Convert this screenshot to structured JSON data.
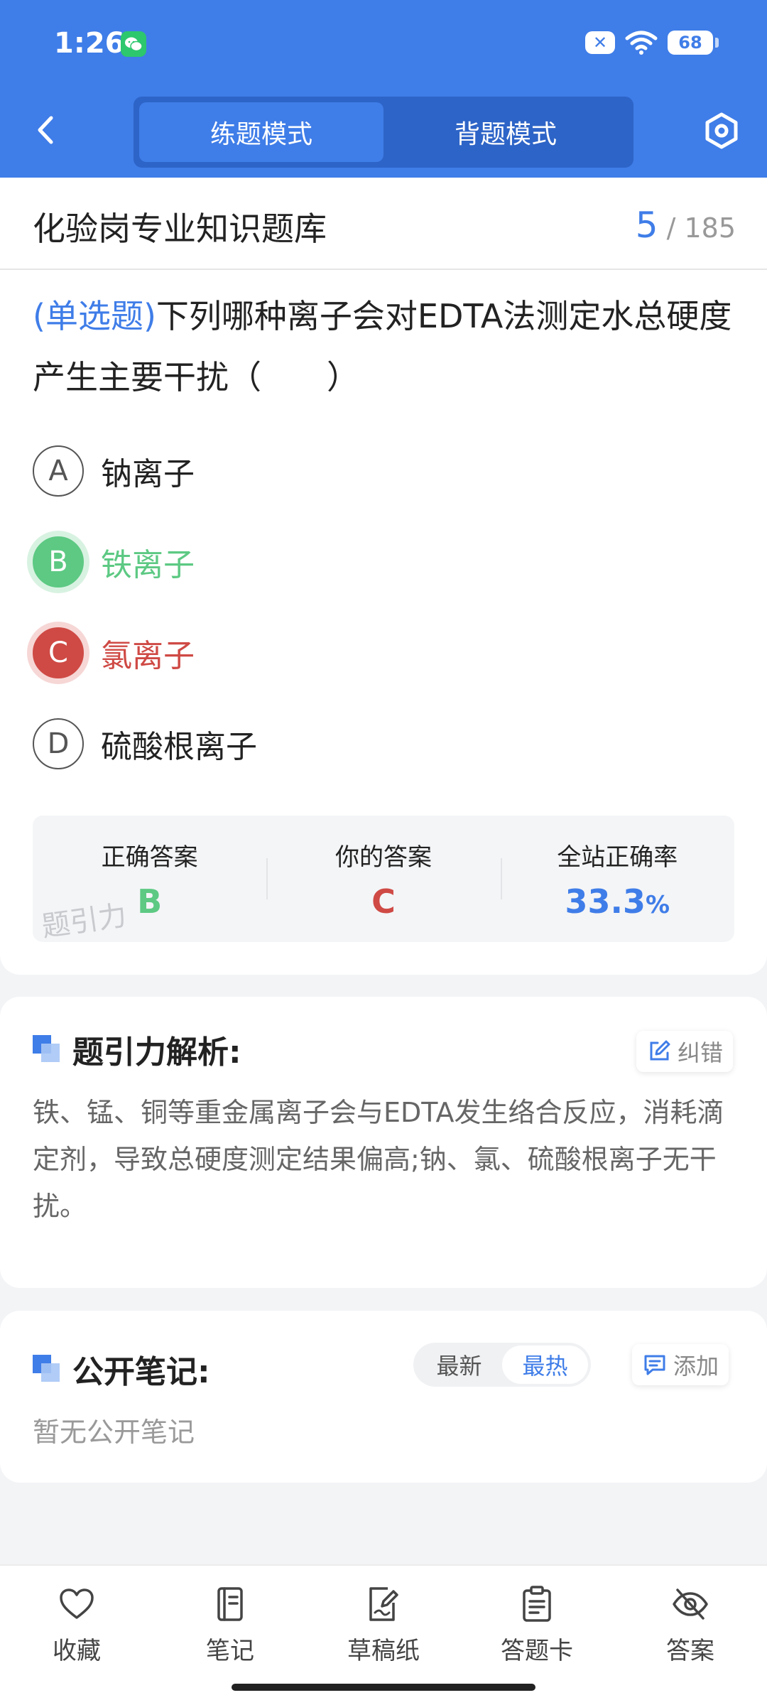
{
  "status_bar": {
    "time": "1:26",
    "battery": "68",
    "muted_badge": "✕"
  },
  "header": {
    "tabs": [
      {
        "label": "练题模式",
        "active": true
      },
      {
        "label": "背题模式",
        "active": false
      }
    ],
    "icons": {
      "back": "chevron-left-icon",
      "settings": "hexagon-gear-icon"
    }
  },
  "titlebar": {
    "title": "化验岗专业知识题库",
    "current": "5",
    "total": "185"
  },
  "question": {
    "type_label": "(单选题)",
    "text": "下列哪种离子会对EDTA法测定水总硬度产生主要干扰（　　）",
    "options": [
      {
        "letter": "A",
        "text": "钠离子",
        "state": "normal"
      },
      {
        "letter": "B",
        "text": "铁离子",
        "state": "correct"
      },
      {
        "letter": "C",
        "text": "氯离子",
        "state": "wrong"
      },
      {
        "letter": "D",
        "text": "硫酸根离子",
        "state": "normal"
      }
    ]
  },
  "answers": {
    "correct_label": "正确答案",
    "correct_value": "B",
    "yours_label": "你的答案",
    "yours_value": "C",
    "rate_label": "全站正确率",
    "rate_value": "33.3",
    "rate_unit": "%",
    "watermark": "题引力"
  },
  "analysis": {
    "title": "题引力解析:",
    "report_label": "纠错",
    "text": "铁、锰、铜等重金属离子会与EDTA发生络合反应，消耗滴定剂，导致总硬度测定结果偏高;钠、氯、硫酸根离子无干扰。"
  },
  "notes": {
    "title": "公开笔记:",
    "sort_options": [
      {
        "label": "最新",
        "active": false
      },
      {
        "label": "最热",
        "active": true
      }
    ],
    "add_label": "添加",
    "empty_text": "暂无公开笔记"
  },
  "bottom_nav": [
    {
      "label": "收藏",
      "icon": "heart-icon"
    },
    {
      "label": "笔记",
      "icon": "notebook-icon"
    },
    {
      "label": "草稿纸",
      "icon": "draft-paper-icon"
    },
    {
      "label": "答题卡",
      "icon": "answer-sheet-icon"
    },
    {
      "label": "答案",
      "icon": "eye-off-icon"
    }
  ],
  "colors": {
    "primary": "#3f7de8",
    "correct": "#5dc983",
    "wrong": "#cf4a45"
  }
}
